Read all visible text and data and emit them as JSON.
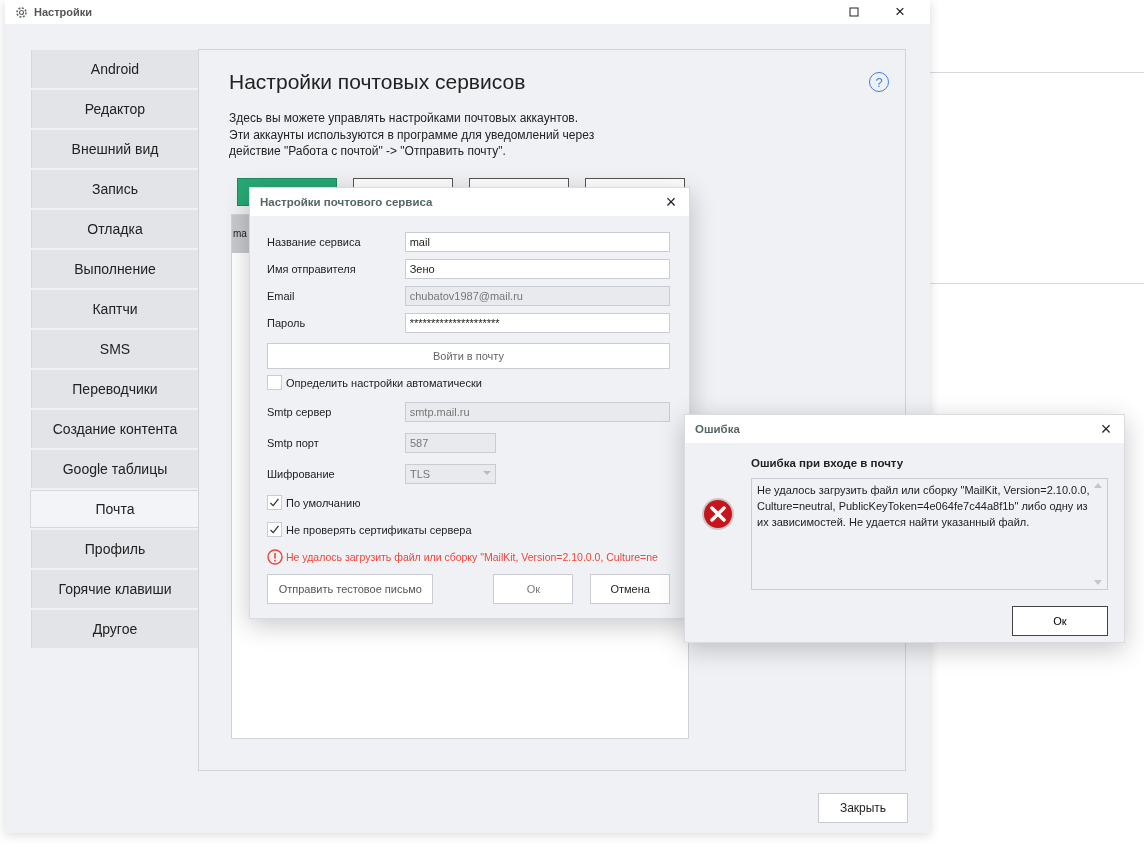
{
  "window": {
    "title": "Настройки",
    "close": "×"
  },
  "sidebar": {
    "items": [
      {
        "label": "Android",
        "selected": false
      },
      {
        "label": "Редактор",
        "selected": false
      },
      {
        "label": "Внешний вид",
        "selected": false
      },
      {
        "label": "Запись",
        "selected": false
      },
      {
        "label": "Отладка",
        "selected": false
      },
      {
        "label": "Выполнение",
        "selected": false
      },
      {
        "label": "Каптчи",
        "selected": false
      },
      {
        "label": "SMS",
        "selected": false
      },
      {
        "label": "Переводчики",
        "selected": false
      },
      {
        "label": "Создание контента",
        "selected": false
      },
      {
        "label": "Google таблицы",
        "selected": false
      },
      {
        "label": "Почта",
        "selected": true
      },
      {
        "label": "Профиль",
        "selected": false
      },
      {
        "label": "Горячие клавиши",
        "selected": false
      },
      {
        "label": "Другое",
        "selected": false
      }
    ]
  },
  "page": {
    "title": "Настройки почтовых сервисов",
    "help": "?",
    "description": [
      "Здесь вы можете управлять настройками почтовых аккаунтов.",
      "Эти аккаунты используются в программе для уведомлений через",
      "действие \"Работа с почтой\" -> \"Отправить почту\"."
    ],
    "toolbar": [
      {
        "kind": "primary"
      },
      {
        "kind": "plain"
      },
      {
        "kind": "plain"
      },
      {
        "kind": "plain"
      }
    ],
    "accounts": [
      {
        "text": "ma",
        "selected": true
      }
    ]
  },
  "close_button": "Закрыть",
  "mail_dialog": {
    "title": "Настройки почтового сервиса",
    "close": "×",
    "fields": [
      {
        "label": "Название сервиса",
        "value": "mail",
        "disabled": false
      },
      {
        "label": "Имя отправителя",
        "value": "Зено",
        "disabled": false
      },
      {
        "label": "Email",
        "value": "chubatov1987@mail.ru",
        "disabled": true
      },
      {
        "label": "Пароль",
        "value": "*********************",
        "disabled": false
      }
    ],
    "login_button": "Войти в почту",
    "auto_detect": {
      "label": "Определить настройки автоматически",
      "checked": false
    },
    "server_fields": [
      {
        "kind": "text",
        "label": "Smtp сервер",
        "value": "smtp.mail.ru",
        "disabled": true
      },
      {
        "kind": "text",
        "label": "Smtp порт",
        "value": "587",
        "disabled": true
      },
      {
        "kind": "select",
        "label": "Шифрование",
        "value": "TLS",
        "disabled": true
      }
    ],
    "options": [
      {
        "label": "По умолчанию",
        "checked": true
      },
      {
        "label": "Не проверять сертификаты сервера",
        "checked": true
      }
    ],
    "error": "Не удалось загрузить файл или сборку \"MailKit, Version=2.10.0.0, Culture=ne",
    "test_button": "Отправить тестовое письмо",
    "ok_button": "Ок",
    "cancel_button": "Отмена"
  },
  "error_dialog": {
    "title": "Ошибка",
    "close": "×",
    "heading": "Ошибка при входе в почту",
    "message": "Не удалось загрузить файл или сборку \"MailKit, Version=2.10.0.0, Culture=neutral, PublicKeyToken=4e064fe7c44a8f1b\" либо одну из их зависимостей. Не удается найти указанный файл.",
    "ok_button": "Ок"
  }
}
